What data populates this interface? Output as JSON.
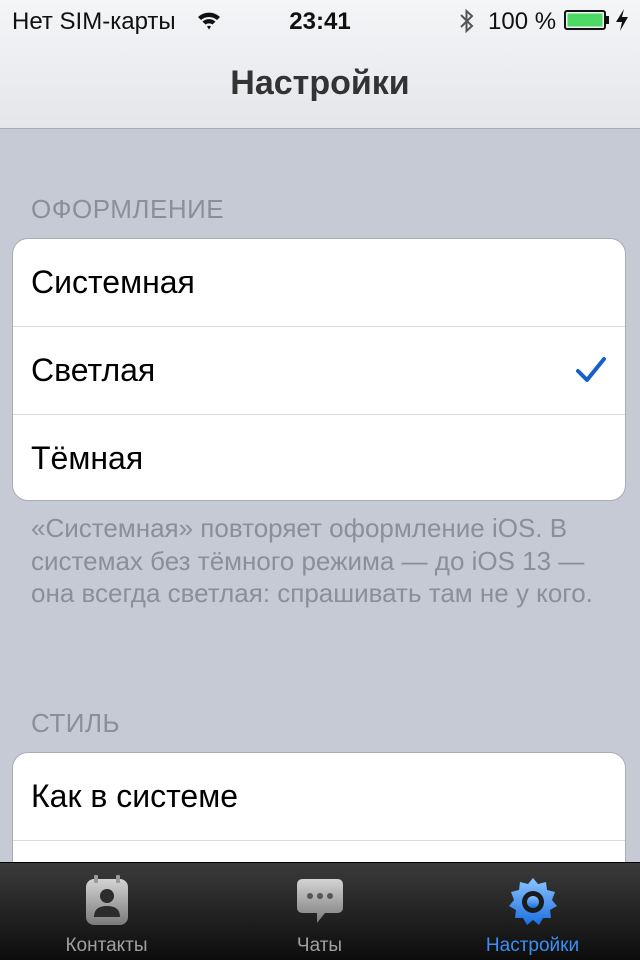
{
  "status_bar": {
    "carrier": "Нет SIM-карты",
    "time": "23:41",
    "battery_percent": "100 %",
    "battery_level": 1.0,
    "icons": [
      "wifi-icon",
      "bluetooth-icon",
      "battery-icon",
      "charging-icon"
    ]
  },
  "nav": {
    "title": "Настройки"
  },
  "appearance": {
    "header": "ОФОРМЛЕНИЕ",
    "options": [
      "Системная",
      "Светлая",
      "Тёмная"
    ],
    "selected": "Светлая",
    "footer": "«Системная» повторяет оформление iOS. В системах без тёмного режима — до iOS 13 — она всегда светлая: спрашивать там не у кого."
  },
  "style": {
    "header": "СТИЛЬ",
    "options": [
      "Как в системе"
    ]
  },
  "tabbar": {
    "items": [
      {
        "label": "Контакты",
        "icon": "contacts-icon",
        "active": false
      },
      {
        "label": "Чаты",
        "icon": "chat-bubble-icon",
        "active": false
      },
      {
        "label": "Настройки",
        "icon": "gear-icon",
        "active": true
      }
    ]
  },
  "colors": {
    "accent": "#3a8ff5",
    "checkmark": "#1560c8",
    "battery": "#4cd964",
    "background": "#c5cad4"
  }
}
